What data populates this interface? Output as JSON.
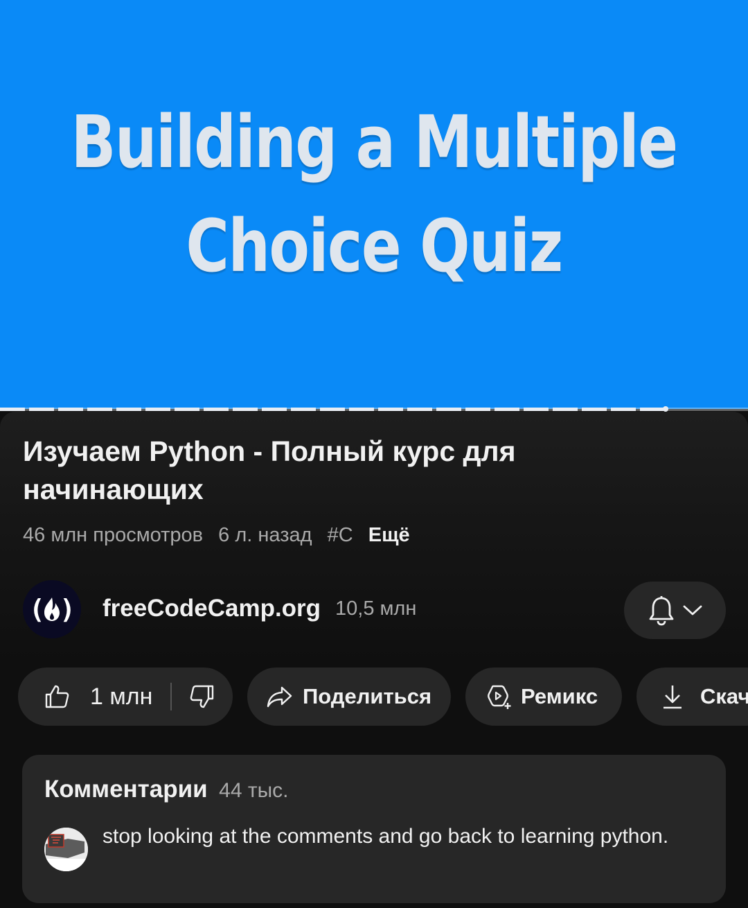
{
  "video": {
    "overlay_line1": "Building a Multiple",
    "overlay_line2": "Choice Quiz",
    "background_color": "#0a8af7",
    "progress_buffered_fraction": 0.89
  },
  "title": "Изучаем Python - Полный курс для начинающих",
  "meta": {
    "views": "46 млн просмотров",
    "age": "6 л. назад",
    "hashtag": "#C",
    "more_label": "Ещё"
  },
  "channel": {
    "avatar_text": "(🔥)",
    "avatar_icon": "freecodecamp-logo",
    "name": "freeCodeCamp.org",
    "subscribers": "10,5 млн"
  },
  "actions": {
    "like_count": "1 млн",
    "share_label": "Поделиться",
    "remix_label": "Ремикс",
    "download_label": "Скачать"
  },
  "comments": {
    "title": "Комментарии",
    "count": "44 тыс.",
    "top_comment": "stop looking at the comments and go back to learning python."
  }
}
